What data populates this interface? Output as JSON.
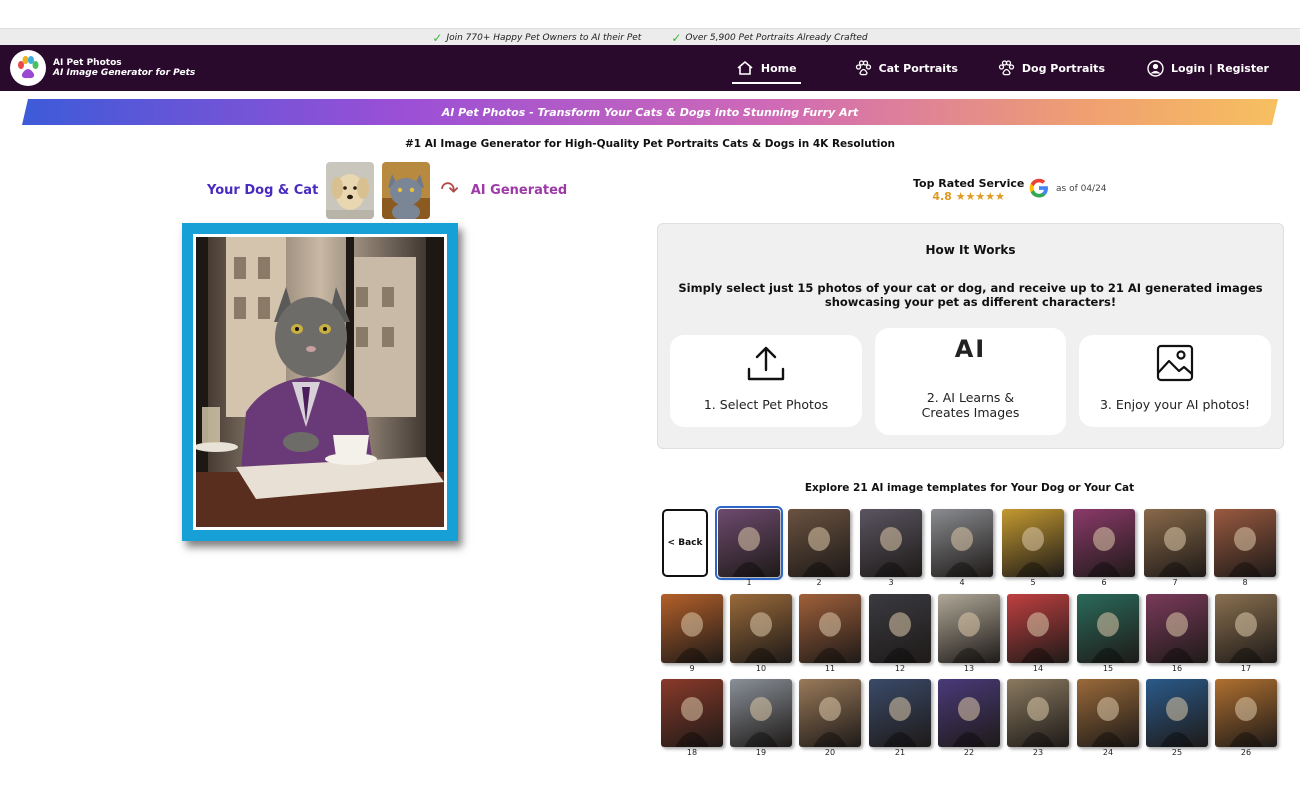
{
  "announce": {
    "item1": "Join 770+ Happy Pet Owners to AI their Pet",
    "item2": "Over 5,900 Pet Portraits Already Crafted"
  },
  "brand": {
    "name": "AI Pet Photos",
    "tagline": "AI Image Generator for Pets"
  },
  "nav": {
    "home": "Home",
    "cat": "Cat Portraits",
    "dog": "Dog Portraits",
    "login": "Login | Register"
  },
  "banner": "AI Pet Photos - Transform Your Cats & Dogs into Stunning Furry Art",
  "headline": "#1 AI Image Generator for High-Quality Pet Portraits Cats & Dogs in 4K Resolution",
  "compare": {
    "left_label": "Your Dog & Cat",
    "right_label": "AI Generated"
  },
  "rating": {
    "title": "Top Rated Service",
    "score": "4.8",
    "stars": "★★★★★",
    "as_of": "as of 04/24"
  },
  "how": {
    "title": "How It Works",
    "desc": "Simply select just 15 photos of your cat or dog, and receive up to 21 AI generated images showcasing your pet as different characters!",
    "step1": "1. Select Pet Photos",
    "step2": "2. AI Learns & Creates Images",
    "step2_icon_text": "AI",
    "step3": "3. Enjoy your AI photos!"
  },
  "explore": {
    "title": "Explore 21 AI image templates for Your Dog or Your Cat",
    "back": "< Back",
    "tiles": [
      {
        "n": "1",
        "c": "#6e4a6e"
      },
      {
        "n": "2",
        "c": "#6a5240"
      },
      {
        "n": "3",
        "c": "#5a5560"
      },
      {
        "n": "4",
        "c": "#8a8c90"
      },
      {
        "n": "5",
        "c": "#c49a30"
      },
      {
        "n": "6",
        "c": "#8c3a6a"
      },
      {
        "n": "7",
        "c": "#8a6a4a"
      },
      {
        "n": "8",
        "c": "#9a5a40"
      },
      {
        "n": "9",
        "c": "#b4602a"
      },
      {
        "n": "10",
        "c": "#9a6a3a"
      },
      {
        "n": "11",
        "c": "#a0603a"
      },
      {
        "n": "12",
        "c": "#3a3a40"
      },
      {
        "n": "13",
        "c": "#b0a898"
      },
      {
        "n": "14",
        "c": "#c04040"
      },
      {
        "n": "15",
        "c": "#2a6a5a"
      },
      {
        "n": "16",
        "c": "#7a3a5a"
      },
      {
        "n": "17",
        "c": "#8a7050"
      },
      {
        "n": "18",
        "c": "#8a3a2a"
      },
      {
        "n": "19",
        "c": "#8a9098"
      },
      {
        "n": "20",
        "c": "#9a7a5a"
      },
      {
        "n": "21",
        "c": "#3a4a6a"
      },
      {
        "n": "22",
        "c": "#4a3a7a"
      },
      {
        "n": "23",
        "c": "#8a7a60"
      },
      {
        "n": "24",
        "c": "#9a6a3a"
      },
      {
        "n": "25",
        "c": "#2a5a8a"
      },
      {
        "n": "26",
        "c": "#b07030"
      }
    ]
  }
}
